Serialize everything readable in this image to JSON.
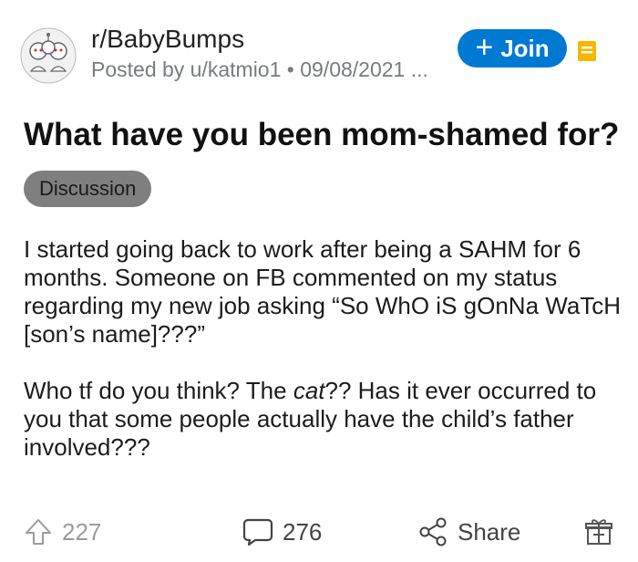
{
  "post": {
    "subreddit": "r/BabyBumps",
    "meta": "Posted by u/katmio1 • 09/08/2021 ...",
    "join_label": "Join",
    "title": "What have you been mom-shamed for?",
    "flair": "Discussion",
    "body": {
      "p1": "I started going back to work after being a SAHM for 6 months. Someone on FB commented on my status regarding my new job asking “So WhO iS gOnNa WaTcH [son’s name]???”",
      "p2_before": "Who tf do you think? The ",
      "p2_em": "cat",
      "p2_after": "?? Has it ever occurred to you that some people actually have the child’s father involved???"
    }
  },
  "actions": {
    "upvotes": "227",
    "comments": "276",
    "share_label": "Share"
  },
  "colors": {
    "join_button": "#0079d3",
    "flair_bg": "#7f7f7f",
    "meta_text": "#787c7e",
    "save_icon": "#f5b800"
  },
  "icons": {
    "upvote": "upvote-arrow-icon",
    "comment": "comment-bubble-icon",
    "share": "share-nodes-icon",
    "award": "gift-award-icon",
    "save": "save-bookmark-icon"
  }
}
